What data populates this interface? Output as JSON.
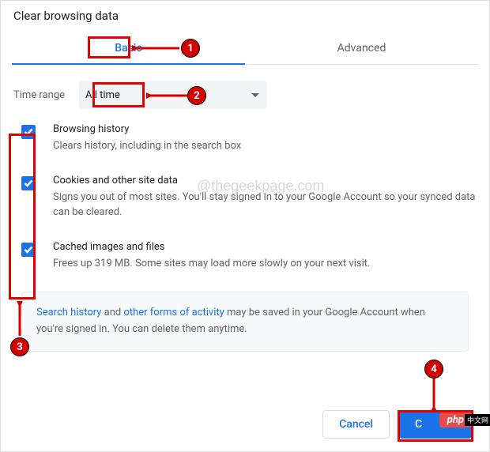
{
  "title": "Clear browsing data",
  "tabs": {
    "basic": "Basic",
    "advanced": "Advanced"
  },
  "time_range": {
    "label": "Time range",
    "value": "All time"
  },
  "items": [
    {
      "title": "Browsing history",
      "desc": "Clears history, including in the search box"
    },
    {
      "title": "Cookies and other site data",
      "desc": "Signs you out of most sites. You'll stay signed in to your Google Account so your synced data can be cleared."
    },
    {
      "title": "Cached images and files",
      "desc": "Frees up 319 MB. Some sites may load more slowly on your next visit."
    }
  ],
  "info": {
    "link1": "Search history",
    "mid1": " and ",
    "link2": "other forms of activity",
    "rest": " may be saved in your Google Account when you're signed in. You can delete them anytime."
  },
  "buttons": {
    "cancel": "Cancel",
    "clear": "C"
  },
  "watermark": "@thegeekpage.com",
  "badge": "php",
  "cn": "中文网",
  "annotations": {
    "n1": "1",
    "n2": "2",
    "n3": "3",
    "n4": "4"
  }
}
